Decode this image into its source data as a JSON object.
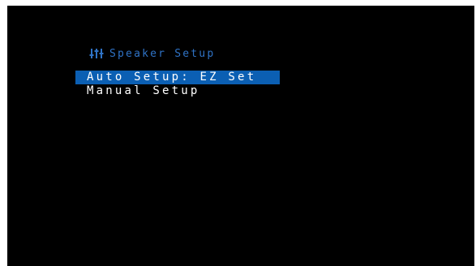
{
  "header": {
    "icon": "speaker-levels-icon",
    "title": "Speaker Setup",
    "color": "#2f73c6"
  },
  "menu": {
    "selected_color": "#0b5fb3",
    "items": [
      {
        "label": "Auto Setup: EZ Set",
        "selected": true
      },
      {
        "label": "Manual Setup",
        "selected": false
      }
    ]
  }
}
